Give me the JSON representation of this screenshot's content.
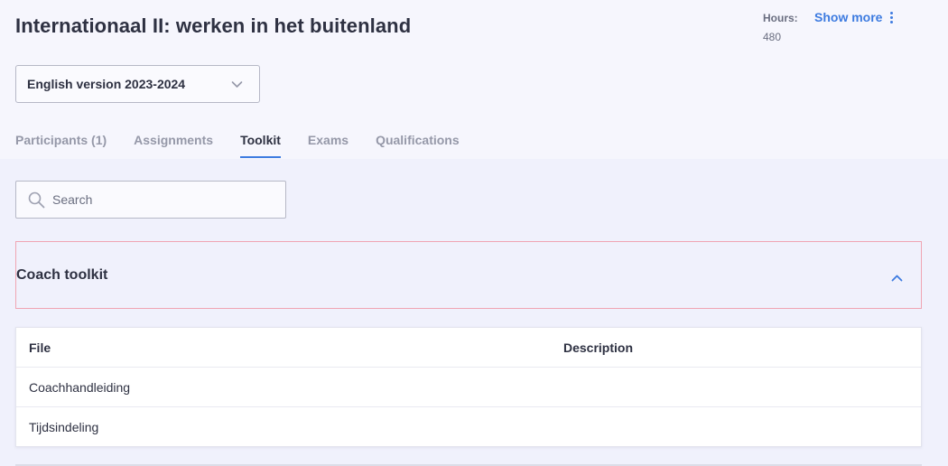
{
  "header": {
    "title": "Internationaal II: werken in het buitenland",
    "hours_label": "Hours:",
    "hours_value": "480",
    "show_more_label": "Show more"
  },
  "version_select": {
    "selected": "English version 2023-2024"
  },
  "tabs": [
    {
      "label": "Participants (1)",
      "active": false
    },
    {
      "label": "Assignments",
      "active": false
    },
    {
      "label": "Toolkit",
      "active": true
    },
    {
      "label": "Exams",
      "active": false
    },
    {
      "label": "Qualifications",
      "active": false
    }
  ],
  "search": {
    "placeholder": "Search"
  },
  "accordion": {
    "title": "Coach toolkit",
    "expanded": true
  },
  "table": {
    "columns": {
      "file": "File",
      "description": "Description"
    },
    "rows": [
      {
        "file": "Coachhandleiding",
        "description": ""
      },
      {
        "file": "Tijdsindeling",
        "description": ""
      }
    ]
  },
  "colors": {
    "accent": "#3d7be0",
    "highlight_border": "#f0a5b3",
    "text": "#2e3142"
  }
}
